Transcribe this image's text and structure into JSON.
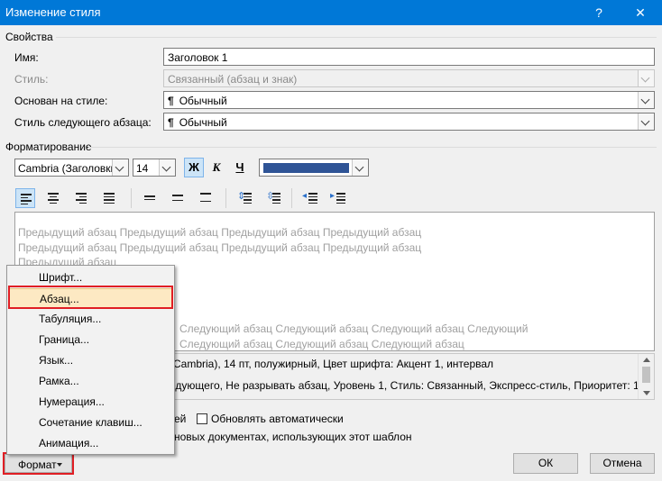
{
  "window": {
    "title": "Изменение стиля",
    "help_glyph": "?",
    "close_glyph": "✕"
  },
  "properties": {
    "section_title": "Свойства",
    "name_label": "Имя:",
    "name_value": "Заголовок 1",
    "style_label": "Стиль:",
    "style_value": "Связанный (абзац и знак)",
    "based_on_label": "Основан на стиле:",
    "based_on_value": "Обычный",
    "next_style_label": "Стиль следующего абзаца:",
    "next_style_value": "Обычный",
    "pilcrow": "¶"
  },
  "formatting": {
    "section_title": "Форматирование",
    "font": "Cambria (Заголовки)",
    "size": "14",
    "bold": "Ж",
    "italic": "К",
    "underline": "Ч",
    "color_hex": "#2f5496"
  },
  "preview": {
    "prev_line1": "Предыдущий абзац Предыдущий абзац Предыдущий абзац Предыдущий абзац",
    "prev_line2": "Предыдущий абзац Предыдущий абзац Предыдущий абзац Предыдущий абзац",
    "prev_line3": "Предыдущий абзац",
    "next_line1": "Следующий абзац Следующий абзац Следующий абзац Следующий",
    "next_line2": "Следующий абзац Следующий абзац Следующий абзац"
  },
  "description": {
    "line1": "(Cambria), 14 пт, полужирный, Цвет шрифта: Акцент 1, интервал",
    "line2": "едующего, Не разрывать абзац, Уровень 1, Стиль: Связанный, Экспресс-стиль, Приоритет: 10"
  },
  "options": {
    "add_fragment": "ей",
    "auto_update": "Обновлять автоматически",
    "template_fragment": "новых документах, использующих этот шаблон"
  },
  "buttons": {
    "format": "Формат",
    "ok": "ОК",
    "cancel": "Отмена"
  },
  "menu": {
    "items": [
      {
        "label": "Шрифт..."
      },
      {
        "label": "Абзац..."
      },
      {
        "label": "Табуляция..."
      },
      {
        "label": "Граница..."
      },
      {
        "label": "Язык..."
      },
      {
        "label": "Рамка..."
      },
      {
        "label": "Нумерация..."
      },
      {
        "label": "Сочетание клавиш..."
      },
      {
        "label": "Анимация..."
      }
    ]
  },
  "colors": {
    "titlebar": "#0078d7",
    "highlight": "#e01e24",
    "menu_hover": "#fde9c3"
  }
}
